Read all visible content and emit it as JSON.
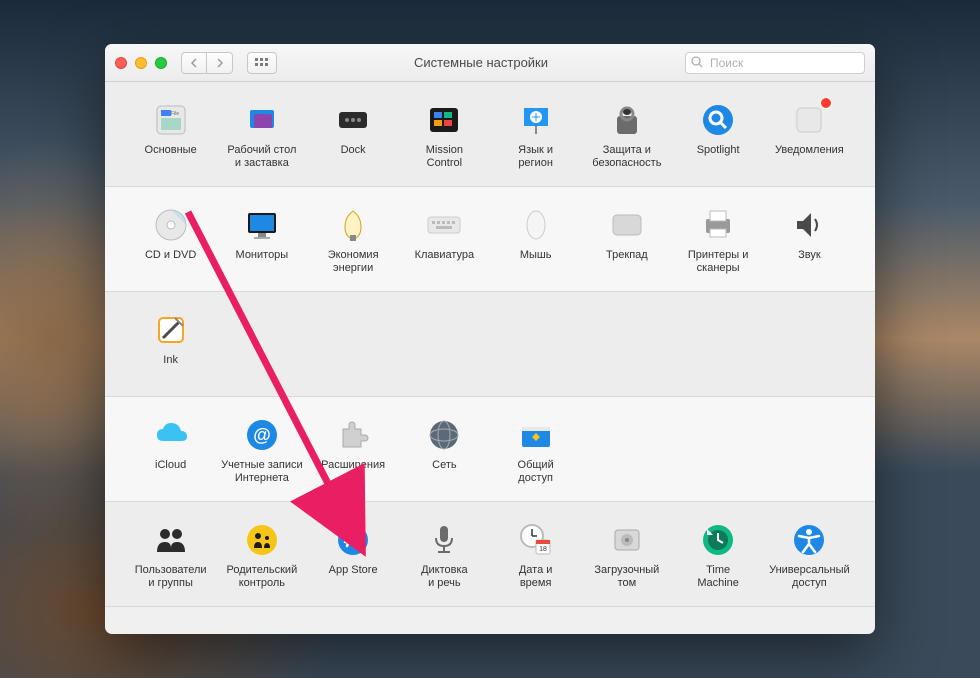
{
  "window": {
    "title": "Системные настройки",
    "search_placeholder": "Поиск"
  },
  "sections": [
    {
      "items": [
        {
          "id": "general",
          "label": "Основные",
          "icon": "general-icon"
        },
        {
          "id": "desktop",
          "label": "Рабочий стол\nи заставка",
          "icon": "desktop-icon"
        },
        {
          "id": "dock",
          "label": "Dock",
          "icon": "dock-icon"
        },
        {
          "id": "mission",
          "label": "Mission\nControl",
          "icon": "mission-control-icon"
        },
        {
          "id": "language",
          "label": "Язык и\nрегион",
          "icon": "language-region-icon"
        },
        {
          "id": "security",
          "label": "Защита и\nбезопасность",
          "icon": "security-icon"
        },
        {
          "id": "spotlight",
          "label": "Spotlight",
          "icon": "spotlight-icon"
        },
        {
          "id": "notifications",
          "label": "Уведомления",
          "icon": "notifications-icon",
          "badge": true
        }
      ]
    },
    {
      "items": [
        {
          "id": "cddvd",
          "label": "CD и DVD",
          "icon": "cd-dvd-icon"
        },
        {
          "id": "displays",
          "label": "Мониторы",
          "icon": "displays-icon"
        },
        {
          "id": "energy",
          "label": "Экономия\nэнергии",
          "icon": "energy-saver-icon"
        },
        {
          "id": "keyboard",
          "label": "Клавиатура",
          "icon": "keyboard-icon"
        },
        {
          "id": "mouse",
          "label": "Мышь",
          "icon": "mouse-icon"
        },
        {
          "id": "trackpad",
          "label": "Трекпад",
          "icon": "trackpad-icon"
        },
        {
          "id": "printers",
          "label": "Принтеры и\nсканеры",
          "icon": "printers-icon"
        },
        {
          "id": "sound",
          "label": "Звук",
          "icon": "sound-icon"
        }
      ]
    },
    {
      "items": [
        {
          "id": "ink",
          "label": "Ink",
          "icon": "ink-icon"
        }
      ]
    },
    {
      "items": [
        {
          "id": "icloud",
          "label": "iCloud",
          "icon": "icloud-icon"
        },
        {
          "id": "internet",
          "label": "Учетные записи\nИнтернета",
          "icon": "internet-accounts-icon"
        },
        {
          "id": "extensions",
          "label": "Расширения",
          "icon": "extensions-icon"
        },
        {
          "id": "network",
          "label": "Сеть",
          "icon": "network-icon"
        },
        {
          "id": "sharing",
          "label": "Общий\nдоступ",
          "icon": "sharing-icon"
        }
      ]
    },
    {
      "items": [
        {
          "id": "users",
          "label": "Пользователи\nи группы",
          "icon": "users-groups-icon"
        },
        {
          "id": "parental",
          "label": "Родительский\nконтроль",
          "icon": "parental-controls-icon"
        },
        {
          "id": "appstore",
          "label": "App Store",
          "icon": "app-store-icon"
        },
        {
          "id": "dictation",
          "label": "Диктовка\nи речь",
          "icon": "dictation-icon"
        },
        {
          "id": "datetime",
          "label": "Дата и\nвремя",
          "icon": "date-time-icon"
        },
        {
          "id": "startup",
          "label": "Загрузочный\nтом",
          "icon": "startup-disk-icon"
        },
        {
          "id": "timemachine",
          "label": "Time\nMachine",
          "icon": "time-machine-icon"
        },
        {
          "id": "accessibility",
          "label": "Универсальный\nдоступ",
          "icon": "accessibility-icon"
        }
      ]
    }
  ],
  "annotation": {
    "arrow_target": "appstore",
    "arrow_color": "#e91e63"
  },
  "icon_svgs": {
    "general-icon": "<rect x='4' y='4' width='28' height='28' rx='4' fill='#e8e8e8' stroke='#bbb'/><rect x='8' y='8' width='10' height='6' fill='#3b82f6'/><text x='18' y='13' font-size='5' fill='#666'>File</text><rect x='8' y='16' width='20' height='12' fill='#a7d8c7'/>",
    "desktop-icon": "<rect x='6' y='8' width='24' height='18' rx='2' fill='#1e88e5'/><rect x='10' y='12' width='18' height='14' rx='2' fill='#8e44ad'/>",
    "dock-icon": "<rect x='4' y='10' width='28' height='16' rx='3' fill='#2c2c2c'/><circle cx='12' cy='18' r='2' fill='#888'/><circle cx='18' cy='18' r='2' fill='#888'/><circle cx='24' cy='18' r='2' fill='#888'/>",
    "mission-control-icon": "<rect x='4' y='6' width='28' height='24' rx='3' fill='#1a1a1a'/><rect x='8' y='10' width='8' height='6' fill='#3b82f6'/><rect x='18' y='10' width='8' height='6' fill='#10b981'/><rect x='8' y='18' width='8' height='6' fill='#f59e0b'/><rect x='18' y='18' width='8' height='6' fill='#ef4444'/>",
    "language-region-icon": "<rect x='6' y='6' width='24' height='18' fill='#2196f3'/><circle cx='18' cy='15' r='6' fill='#fff'/><path d='M14 15 h8 M18 11 v8' stroke='#2196f3' stroke-width='1'/><rect x='17' y='24' width='2' height='8' fill='#888'/>",
    "security-icon": "<rect x='8' y='14' width='20' height='18' rx='3' fill='#6b6b6b'/><rect x='12' y='6' width='12' height='12' rx='6' fill='none' stroke='#888' stroke-width='3'/><ellipse cx='18' cy='10' rx='4' ry='3' fill='#333'/>",
    "spotlight-icon": "<circle cx='18' cy='18' r='15' fill='#1e88e5'/><circle cx='16' cy='16' r='6' fill='none' stroke='#fff' stroke-width='3'/><line x1='21' y1='21' x2='26' y2='26' stroke='#fff' stroke-width='3'/>",
    "notifications-icon": "<rect x='6' y='6' width='24' height='24' rx='4' fill='#e8e8e8' stroke='#ccc'/>",
    "cd-dvd-icon": "<circle cx='18' cy='18' r='15' fill='#e8e8e8' stroke='#bbb'/><circle cx='18' cy='18' r='4' fill='#fff' stroke='#bbb'/><path d='M18 3 A15 15 0 0 1 33 18' fill='#b8d8e8' opacity='0.6'/>",
    "displays-icon": "<rect x='4' y='6' width='28' height='20' rx='2' fill='#1a1a1a'/><rect x='6' y='8' width='24' height='16' fill='#1e88e5'/><rect x='14' y='26' width='8' height='4' fill='#888'/><rect x='10' y='30' width='16' height='2' fill='#aaa'/>",
    "energy-saver-icon": "<path d='M18 4 Q10 10 10 20 Q10 30 18 32 Q26 30 26 20 Q26 10 18 4' fill='#fff3c4' stroke='#d4a017'/><rect x='15' y='28' width='6' height='6' fill='#888'/>",
    "keyboard-icon": "<rect x='2' y='10' width='32' height='16' rx='3' fill='#e8e8e8' stroke='#ccc'/><rect x='6' y='14' width='3' height='3' fill='#bbb'/><rect x='11' y='14' width='3' height='3' fill='#bbb'/><rect x='16' y='14' width='3' height='3' fill='#bbb'/><rect x='21' y='14' width='3' height='3' fill='#bbb'/><rect x='26' y='14' width='3' height='3' fill='#bbb'/><rect x='10' y='19' width='16' height='3' fill='#bbb'/>",
    "mouse-icon": "<ellipse cx='18' cy='18' rx='9' ry='14' fill='#f5f5f5' stroke='#ccc'/>",
    "trackpad-icon": "<rect x='4' y='8' width='28' height='20' rx='4' fill='#d8d8d8' stroke='#bbb'/>",
    "printers-icon": "<rect x='6' y='12' width='24' height='14' rx='2' fill='#999'/><rect x='10' y='4' width='16' height='10' fill='#fff' stroke='#bbb'/><rect x='10' y='22' width='16' height='8' fill='#fff' stroke='#bbb'/>",
    "sound-icon": "<path d='M6 14 L12 14 L20 6 L20 30 L12 22 L6 22 Z' fill='#4a4a4a'/><path d='M24 12 Q28 18 24 24' fill='none' stroke='#4a4a4a' stroke-width='2'/>",
    "ink-icon": "<rect x='6' y='6' width='24' height='24' rx='4' fill='#fff' stroke='#f5a623' stroke-width='2'/><path d='M10 26 L26 10' stroke='#4a4a4a' stroke-width='3'/><path d='M22 6 L30 14' stroke='#888' stroke-width='2'/>",
    "icloud-icon": "<path d='M10 24 Q4 24 4 18 Q4 12 10 12 Q12 6 18 6 Q26 6 28 14 Q34 14 34 20 Q34 24 28 24 Z' fill='#3ac3f2'/>",
    "internet-accounts-icon": "<circle cx='18' cy='18' r='15' fill='#1e88e5'/><text x='18' y='24' font-size='18' fill='#fff' text-anchor='middle' font-weight='bold'>@</text>",
    "extensions-icon": "<path d='M8 12 h6 v-4 a3 3 0 0 1 6 0 v4 h6 v6 h4 a3 3 0 0 1 0 6 h-4 v6 h-18 z' fill='#d0d0d0' stroke='#aaa'/>",
    "network-icon": "<circle cx='18' cy='18' r='14' fill='#5a6a7a'/><ellipse cx='18' cy='18' rx='14' ry='6' fill='none' stroke='#aaa'/><ellipse cx='18' cy='18' rx='6' ry='14' fill='none' stroke='#aaa'/>",
    "sharing-icon": "<rect x='4' y='10' width='28' height='20' rx='2' fill='#1e88e5'/><rect x='4' y='10' width='28' height='4' fill='#e8e8e8'/><path d='M14 20 l4 -4 l4 4 l-4 4 z' fill='#f5c518'/>",
    "users-groups-icon": "<circle cx='12' cy='12' r='5' fill='#2c2c2c'/><circle cx='24' cy='12' r='5' fill='#2c2c2c'/><path d='M4 30 Q4 20 12 20 Q18 20 18 26 Q18 20 24 20 Q32 20 32 30 Z' fill='#2c2c2c'/>",
    "parental-controls-icon": "<circle cx='18' cy='18' r='15' fill='#f5c518'/><circle cx='14' cy='14' r='3' fill='#1a1a1a'/><path d='M10 26 Q10 20 14 20 Q18 20 18 26' fill='#1a1a1a'/><circle cx='23' cy='16' r='2' fill='#1a1a1a'/><path d='M20 26 Q20 21 23 21 Q26 21 26 26' fill='#1a1a1a'/>",
    "app-store-icon": "<circle cx='18' cy='18' r='15' fill='#1e88e5'/><path d='M18 8 L12 24 M18 8 L24 24 M10 20 L26 20' stroke='#fff' stroke-width='2.5' stroke-linecap='round'/>",
    "dictation-icon": "<rect x='14' y='4' width='8' height='16' rx='4' fill='#6b6b6b'/><path d='M10 16 Q10 24 18 24 Q26 24 26 16' fill='none' stroke='#6b6b6b' stroke-width='2'/><line x1='18' y1='24' x2='18' y2='30' stroke='#6b6b6b' stroke-width='2'/><line x1='12' y1='30' x2='24' y2='30' stroke='#6b6b6b' stroke-width='2'/>",
    "date-time-icon": "<circle cx='14' cy='14' r='11' fill='#fff' stroke='#bbb' stroke-width='2'/><line x1='14' y1='14' x2='14' y2='7' stroke='#333' stroke-width='1.5'/><line x1='14' y1='14' x2='19' y2='14' stroke='#333' stroke-width='1.5'/><rect x='18' y='18' width='14' height='14' rx='2' fill='#fff' stroke='#bbb'/><rect x='18' y='18' width='14' height='4' fill='#e74c3c'/><text x='25' y='29' font-size='7' text-anchor='middle' fill='#333'>18</text>",
    "startup-disk-icon": "<rect x='6' y='8' width='24' height='20' rx='3' fill='#d8d8d8' stroke='#aaa'/><circle cx='18' cy='18' r='6' fill='#bbb'/><circle cx='18' cy='18' r='2' fill='#888'/>",
    "time-machine-icon": "<circle cx='18' cy='18' r='15' fill='#10b981'/><circle cx='18' cy='18' r='10' fill='#0d7a5a'/><path d='M18 11 L18 18 L23 21' stroke='#fff' stroke-width='2' fill='none'/><path d='M10 10 l-3 -3 l0 6 l6 0 z' fill='#fff'/>",
    "accessibility-icon": "<circle cx='18' cy='18' r='15' fill='#1e88e5'/><circle cx='18' cy='10' r='3' fill='#fff'/><path d='M8 14 L18 16 L28 14 M18 16 L18 22 L12 30 M18 22 L24 30' stroke='#fff' stroke-width='2.5' fill='none' stroke-linecap='round'/>"
  }
}
